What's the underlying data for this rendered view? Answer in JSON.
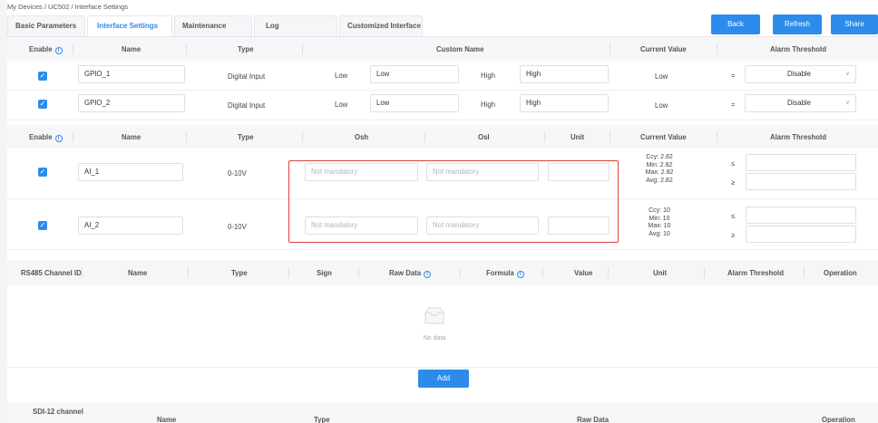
{
  "breadcrumb": {
    "root": "My Devices",
    "device": "UC502",
    "page": "Interface Settings"
  },
  "tabs": [
    {
      "label": "Basic Parameters"
    },
    {
      "label": "Interface Settings"
    },
    {
      "label": "Maintenance"
    },
    {
      "label": "Log"
    },
    {
      "label": "Customized Interface"
    }
  ],
  "actions": {
    "back": "Back",
    "refresh": "Refresh",
    "share": "Share"
  },
  "gpio": {
    "headers": {
      "enable": "Enable",
      "name": "Name",
      "type": "Type",
      "custom_name": "Custom Name",
      "current_value": "Current Value",
      "alarm_threshold": "Alarm Threshold"
    },
    "rows": [
      {
        "name": "GPIO_1",
        "type": "Digital Input",
        "low_label": "Low",
        "low_value": "Low",
        "high_label": "High",
        "high_value": "High",
        "current": "Low",
        "op": "=",
        "alarm": "Disable"
      },
      {
        "name": "GPIO_2",
        "type": "Digital Input",
        "low_label": "Low",
        "low_value": "Low",
        "high_label": "High",
        "high_value": "High",
        "current": "Low",
        "op": "=",
        "alarm": "Disable"
      }
    ]
  },
  "analog": {
    "headers": {
      "enable": "Enable",
      "name": "Name",
      "type": "Type",
      "osh": "Osh",
      "osl": "Osl",
      "unit": "Unit",
      "current_value": "Current Value",
      "alarm_threshold": "Alarm Threshold"
    },
    "rows": [
      {
        "name": "AI_1",
        "type": "0-10V",
        "osh_placeholder": "Not mandatory",
        "osl_placeholder": "Not mandatory",
        "ccy": "Ccy: 2.82",
        "min": "Min: 2.82",
        "max": "Max: 2.82",
        "avg": "Avg: 2.82",
        "le": "≤",
        "ge": "≥"
      },
      {
        "name": "AI_2",
        "type": "0-10V",
        "osh_placeholder": "Not mandatory",
        "osl_placeholder": "Not mandatory",
        "ccy": "Ccy: 10",
        "min": "Min: 10",
        "max": "Max: 10",
        "avg": "Avg: 10",
        "le": "≤",
        "ge": "≥"
      }
    ]
  },
  "rs485": {
    "headers": {
      "channel_id": "RS485 Channel ID",
      "name": "Name",
      "type": "Type",
      "sign": "Sign",
      "raw_data": "Raw Data",
      "formula": "Formula",
      "value": "Value",
      "unit": "Unit",
      "alarm_threshold": "Alarm Threshold",
      "operation": "Operation"
    },
    "empty_text": "No data",
    "add_label": "Add"
  },
  "sdi12": {
    "headers": {
      "channel": "SDI-12 channel",
      "name": "Name",
      "type": "Type",
      "raw_data": "Raw Data",
      "operation": "Operation"
    }
  },
  "colors": {
    "accent": "#2d8ceb",
    "highlight_border": "#e0403a"
  },
  "icons": {
    "info": "info-circle-icon",
    "checkbox": "checkbox-checked-icon",
    "dropdown": "chevron-down-icon",
    "empty": "empty-inbox-icon"
  }
}
